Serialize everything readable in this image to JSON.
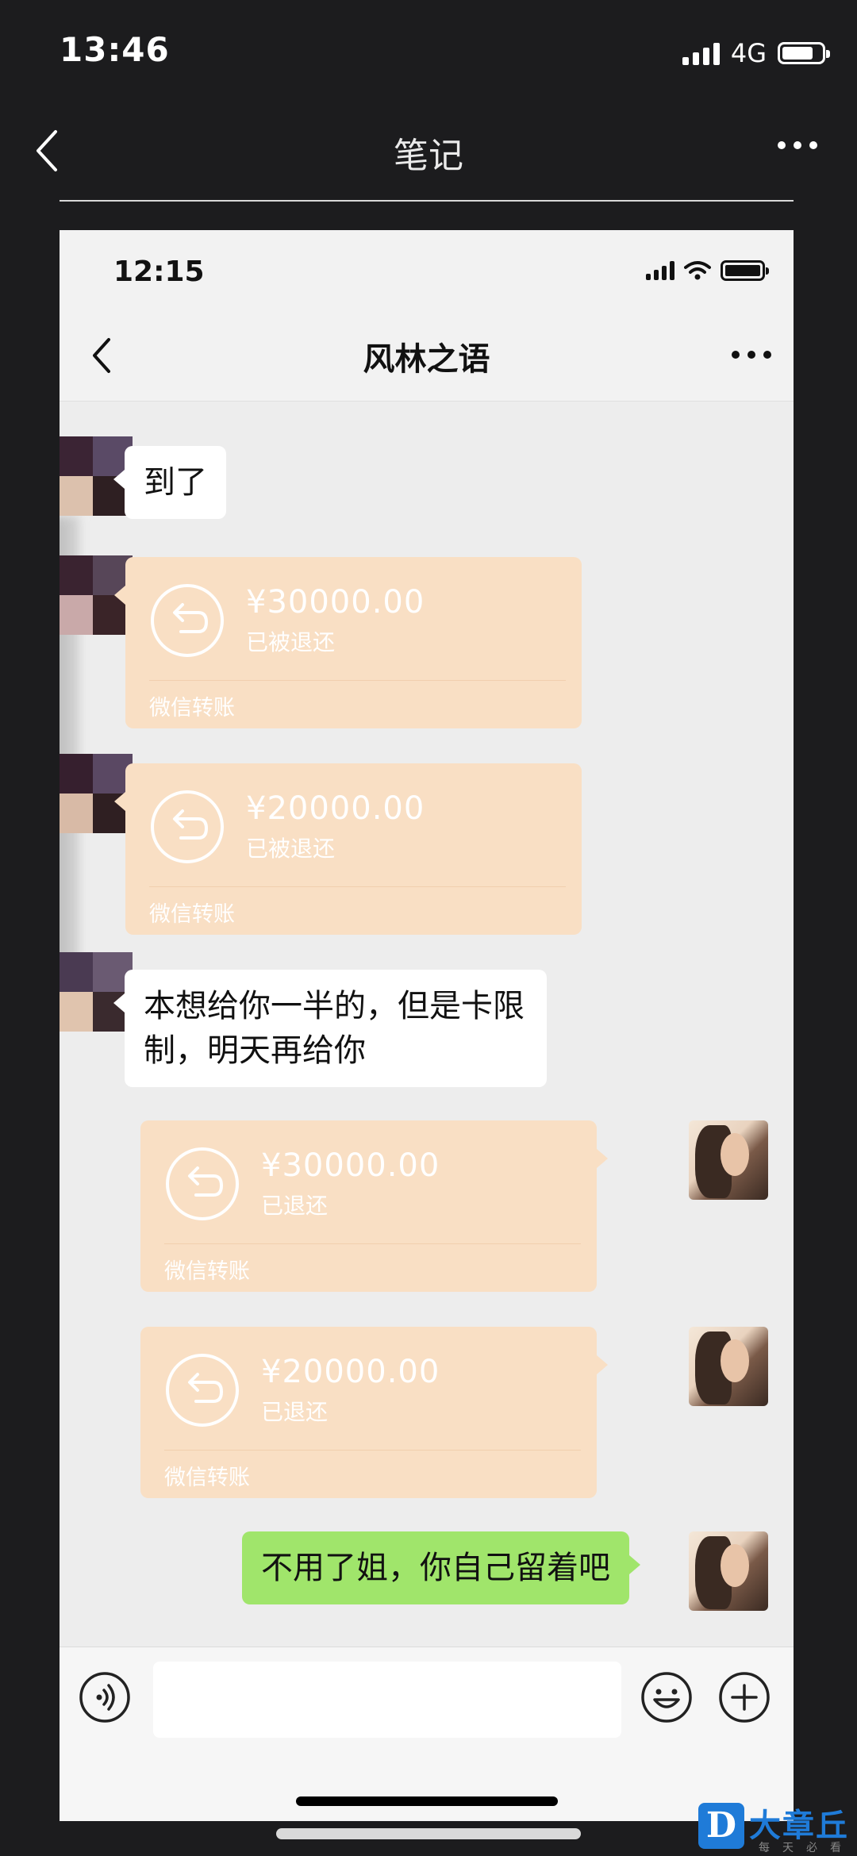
{
  "outer": {
    "time": "13:46",
    "network": "4G",
    "title": "笔记"
  },
  "inner": {
    "time": "12:15",
    "chat_title": "风林之语"
  },
  "messages": [
    {
      "type": "text",
      "side": "left",
      "text": "到了"
    },
    {
      "type": "transfer",
      "side": "left",
      "amount": "¥30000.00",
      "status": "已被退还",
      "label": "微信转账"
    },
    {
      "type": "transfer",
      "side": "left",
      "amount": "¥20000.00",
      "status": "已被退还",
      "label": "微信转账"
    },
    {
      "type": "text",
      "side": "left",
      "text": "本想给你一半的，但是卡限制，明天再给你"
    },
    {
      "type": "transfer",
      "side": "right",
      "amount": "¥30000.00",
      "status": "已退还",
      "label": "微信转账"
    },
    {
      "type": "transfer",
      "side": "right",
      "amount": "¥20000.00",
      "status": "已退还",
      "label": "微信转账"
    },
    {
      "type": "text",
      "side": "right",
      "text": "不用了姐，你自己留着吧"
    }
  ],
  "input_bar": {
    "icons": [
      "voice-icon",
      "emoji-icon",
      "plus-icon"
    ],
    "value": ""
  },
  "watermark": {
    "logo": "D",
    "text": "大章丘",
    "sub": "每天必看"
  },
  "colors": {
    "transfer_bg": "#f9dfc4",
    "sent_bubble": "#a0e56b",
    "chat_bg": "#ededed",
    "app_bg": "#1c1c1e"
  }
}
